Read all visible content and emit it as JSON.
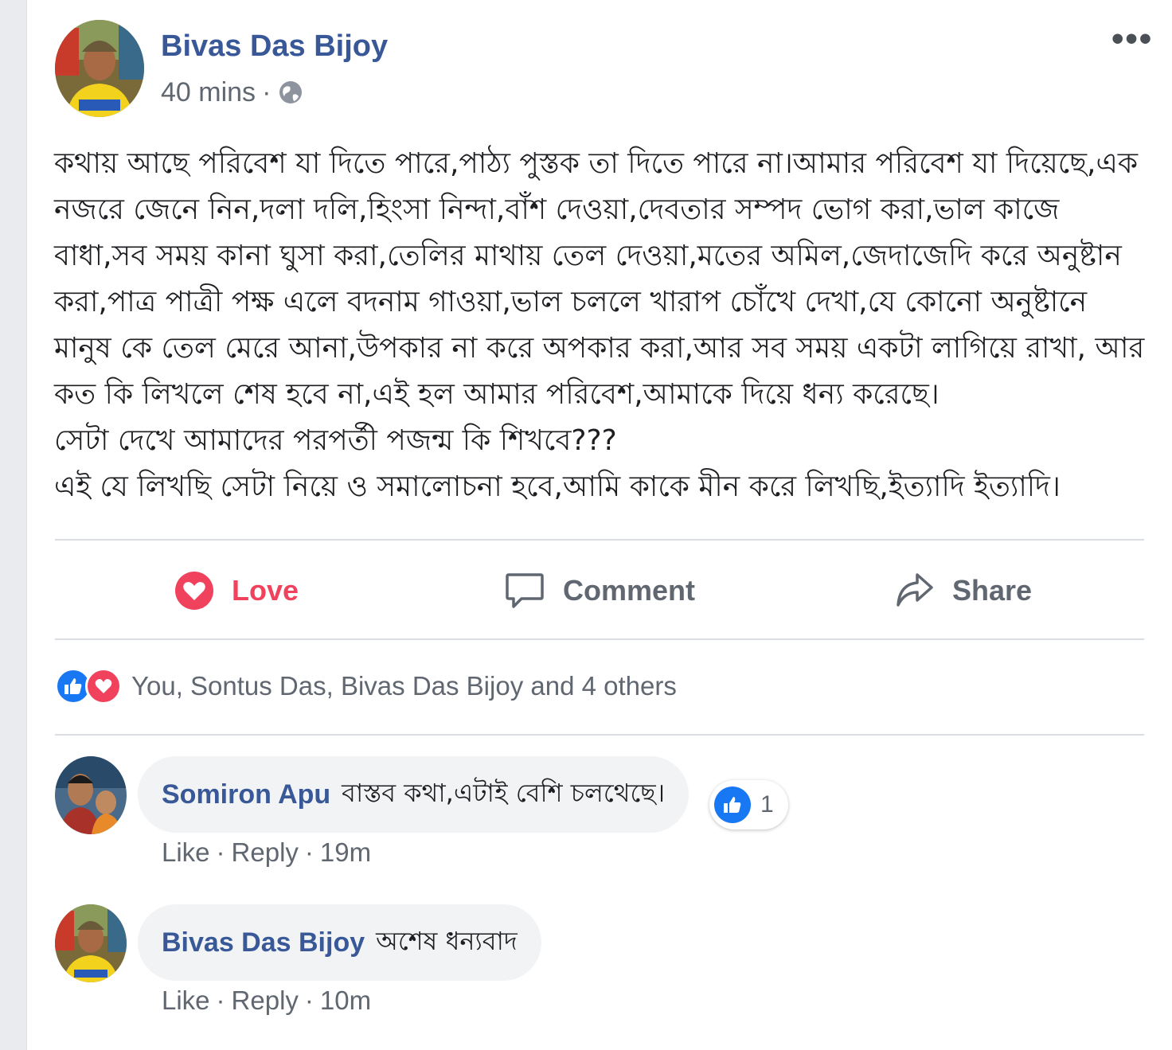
{
  "post": {
    "author": "Bivas Das Bijoy",
    "time": "40 mins",
    "separator": "·",
    "more_label": "•••",
    "body": [
      "কথায় আছে পরিবেশ যা দিতে পারে,পাঠ্য পুস্তক তা দিতে পারে না।আমার পরিবেশ যা দিয়েছে,এক নজরে জেনে নিন,দলা দলি,হিংসা নিন্দা,বাঁশ দেওয়া,দেবতার সম্পদ ভোগ করা,ভাল কাজে বাধা,সব সময় কানা ঘুসা করা,তেলির মাথায় তেল দেওয়া,মতের অমিল,জেদাজেদি করে অনুষ্টান করা,পাত্র পাত্রী পক্ষ এলে বদনাম গাওয়া,ভাল চললে খারাপ চোঁখে দেখা,যে কোনো অনুষ্টানে মানুষ কে তেল মেরে আনা,উপকার না করে অপকার করা,আর সব সময় একটা লাগিয়ে রাখা, আর কত কি লিখলে শেষ হবে না,এই হল আমার পরিবেশ,আমাকে দিয়ে ধন্য করেছে।",
      "সেটা দেখে আমাদের পরপর্তী পজন্ম কি শিখবে???",
      "এই যে লিখছি সেটা নিয়ে ও সমালোচনা হবে,আমি কাকে মীন করে লিখছি,ইত্যাদি ইত্যাদি।"
    ]
  },
  "actions": {
    "love": "Love",
    "comment": "Comment",
    "share": "Share"
  },
  "reactions_summary": "You, Sontus Das, Bivas Das Bijoy and 4 others",
  "comments": [
    {
      "name": "Somiron Apu",
      "text": "বাস্তব কথা,এটাই বেশি চলথেছে।",
      "like": "Like",
      "reply": "Reply",
      "time": "19m",
      "like_count": "1"
    },
    {
      "name": "Bivas Das Bijoy",
      "text": "অশেষ ধন্যবাদ",
      "like": "Like",
      "reply": "Reply",
      "time": "10m"
    }
  ],
  "colors": {
    "link_blue": "#385898",
    "love_red": "#f0425c",
    "like_blue": "#1877f2",
    "meta_gray": "#606770"
  },
  "icons": [
    "globe-icon",
    "more-icon",
    "love-icon",
    "comment-icon",
    "share-icon",
    "like-reaction-icon",
    "love-reaction-icon"
  ]
}
